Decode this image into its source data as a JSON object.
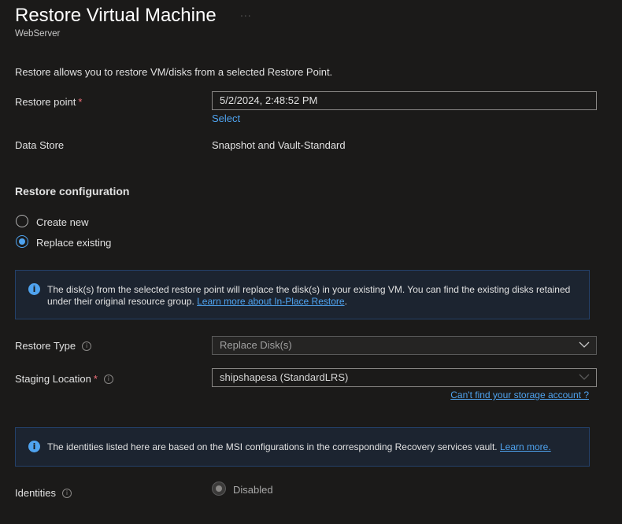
{
  "header": {
    "title": "Restore Virtual Machine",
    "more_label": "...",
    "subtitle": "WebServer"
  },
  "description": "Restore allows you to restore VM/disks from a selected Restore Point.",
  "restore_point": {
    "label": "Restore point",
    "required_marker": "*",
    "value": "5/2/2024, 2:48:52 PM",
    "select_link": "Select"
  },
  "data_store": {
    "label": "Data Store",
    "value": "Snapshot and Vault-Standard"
  },
  "restore_configuration": {
    "heading": "Restore configuration",
    "options": [
      {
        "label": "Create new",
        "selected": false
      },
      {
        "label": "Replace existing",
        "selected": true
      }
    ]
  },
  "info1": {
    "icon": "info-icon",
    "text": "The disk(s) from the selected restore point will replace the disk(s) in your existing VM. You can find the existing disks retained under their original resource group.",
    "link": "Learn more about In-Place Restore",
    "trailing": "."
  },
  "restore_type": {
    "label": "Restore Type",
    "value": "Replace Disk(s)"
  },
  "staging_location": {
    "label": "Staging Location",
    "required_marker": "*",
    "value": "shipshapesa (StandardLRS)",
    "help_link": "Can't find your storage account ?"
  },
  "info2": {
    "icon": "info-icon",
    "text": "The identities listed here are based on the MSI configurations in the corresponding Recovery services vault.",
    "link": "Learn more."
  },
  "identities": {
    "label": "Identities",
    "option": "Disabled"
  },
  "colors": {
    "background": "#1b1a19",
    "accent": "#4fa3ef",
    "required": "#f1707b"
  }
}
